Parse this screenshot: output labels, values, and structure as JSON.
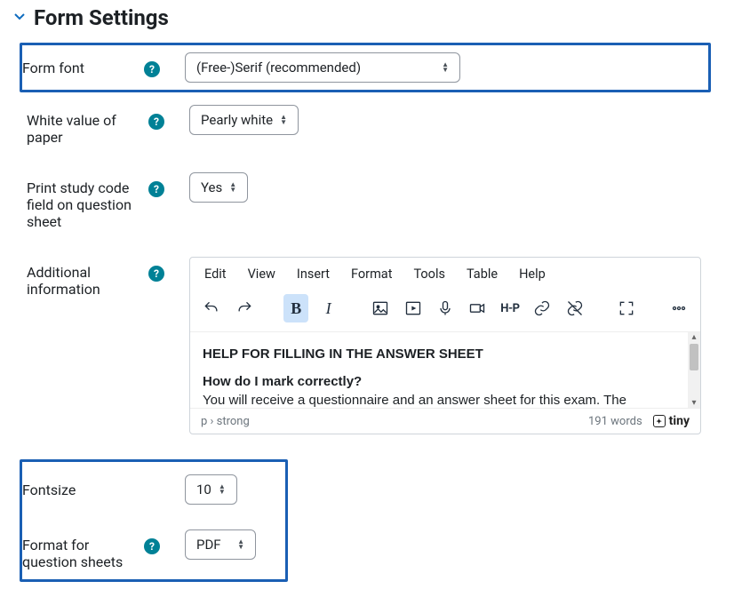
{
  "section_title": "Form Settings",
  "fields": {
    "font": {
      "label": "Form font",
      "value": "(Free-)Serif (recommended)"
    },
    "white": {
      "label": "White value of paper",
      "value": "Pearly white"
    },
    "studycode": {
      "label": "Print study code field on question sheet",
      "value": "Yes"
    },
    "additional": {
      "label": "Additional information"
    },
    "fontsize": {
      "label": "Fontsize",
      "value": "10"
    },
    "format": {
      "label": "Format for question sheets",
      "value": "PDF"
    }
  },
  "editor": {
    "menu": {
      "edit": "Edit",
      "view": "View",
      "insert": "Insert",
      "format": "Format",
      "tools": "Tools",
      "table": "Table",
      "help": "Help"
    },
    "content": {
      "heading": "HELP FOR FILLING IN THE ANSWER SHEET",
      "subheading": "How do I mark correctly?",
      "body": "You will receive a questionnaire and an answer sheet for this exam. The"
    },
    "status_path": "p › strong",
    "word_count": "191 words",
    "brand": "tiny",
    "h5p_label": "H-P"
  }
}
